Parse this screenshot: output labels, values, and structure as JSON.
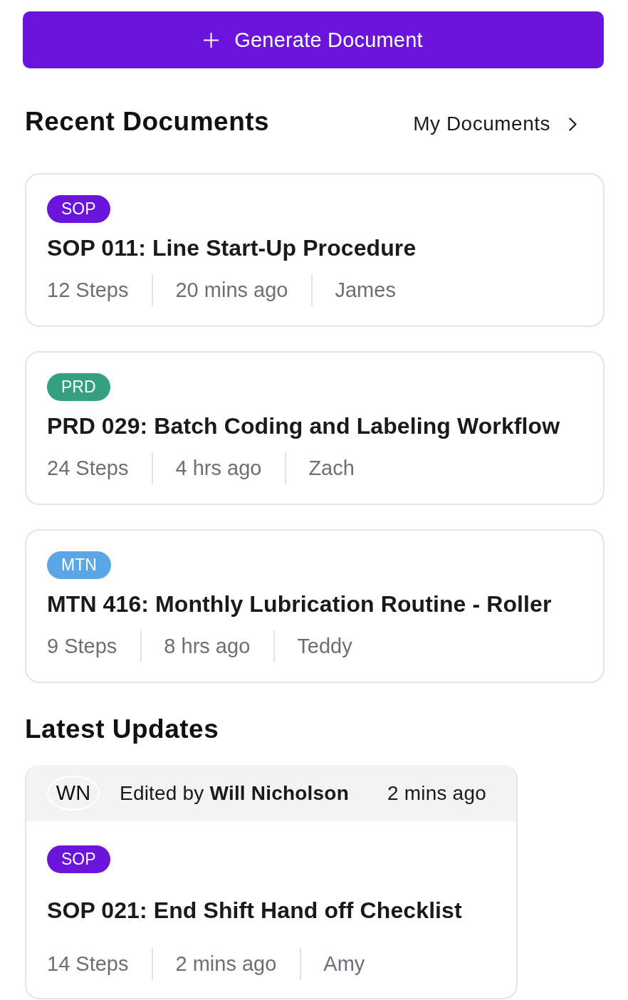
{
  "generate_button": {
    "label": "Generate Document"
  },
  "recent_documents": {
    "title": "Recent Documents",
    "link": "My Documents",
    "documents": [
      {
        "tag": "SOP",
        "color": "#6a14dc",
        "title": "SOP 011: Line Start-Up Procedure",
        "steps": "12 Steps",
        "time": "20 mins ago",
        "author": "James"
      },
      {
        "tag": "PRD",
        "color": "#35a07f",
        "title": "PRD 029: Batch Coding and Labeling Workflow",
        "steps": "24 Steps",
        "time": "4 hrs ago",
        "author": "Zach"
      },
      {
        "tag": "MTN",
        "color": "#5aa6e6",
        "title": "MTN 416: Monthly Lubrication Routine - Roller",
        "steps": "9 Steps",
        "time": "8 hrs ago",
        "author": "Teddy"
      }
    ]
  },
  "latest_updates": {
    "title": "Latest Updates",
    "updates": [
      {
        "initials": "WN",
        "edited": "Edited by **Will Nicholson**",
        "time": "2 mins ago",
        "document": {
          "tag": "SOP",
          "color": "#6a14dc",
          "title": "SOP 021: End Shift Hand off Checklist",
          "steps": "14 Steps",
          "time": "2 mins ago",
          "author": "Amy"
        }
      }
    ]
  }
}
